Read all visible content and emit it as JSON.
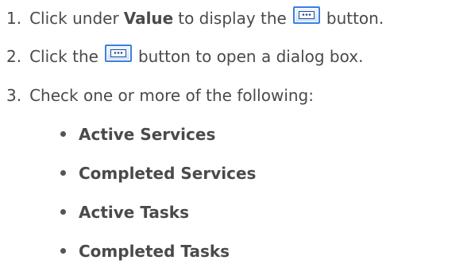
{
  "steps": [
    {
      "number": "1.",
      "before": "Click under",
      "bold": "Value",
      "after": "to display the",
      "icon": "ellipsis-button-icon",
      "tail": "button."
    },
    {
      "number": "2.",
      "before": "Click the",
      "icon": "ellipsis-button-icon",
      "after": "button to open a dialog box."
    },
    {
      "number": "3.",
      "text": "Check one or more of the following:"
    }
  ],
  "options": [
    "Active Services",
    "Completed Services",
    "Active Tasks",
    "Completed Tasks"
  ]
}
